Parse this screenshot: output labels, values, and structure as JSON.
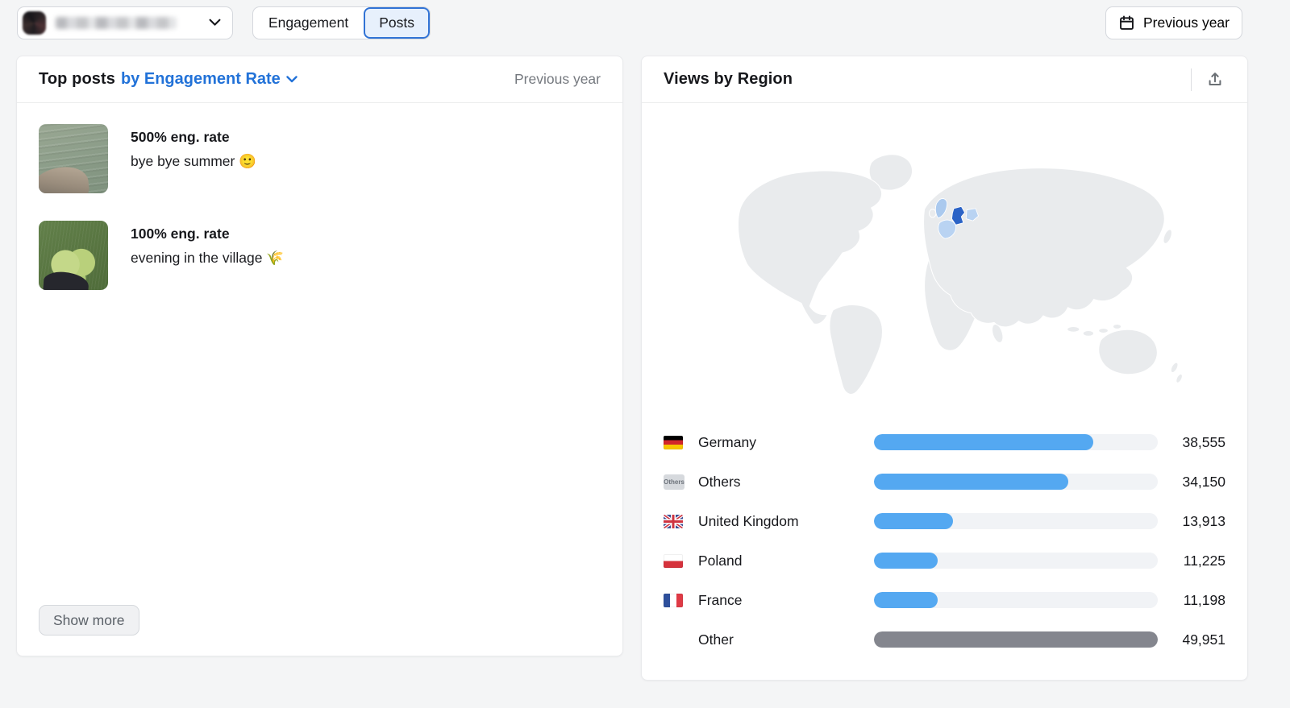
{
  "topbar": {
    "account_selector": {
      "name_redacted": true
    },
    "view_tabs": [
      {
        "label": "Engagement",
        "active": false
      },
      {
        "label": "Posts",
        "active": true
      }
    ],
    "period_button_label": "Previous year"
  },
  "top_posts_panel": {
    "title": "Top posts",
    "sort_selector_label": "by Engagement Rate",
    "period_label": "Previous year",
    "posts": [
      {
        "rate": "500% eng. rate",
        "caption": "bye bye summer 🙂"
      },
      {
        "rate": "100% eng. rate",
        "caption": "evening in the village 🌾"
      }
    ],
    "show_more_label": "Show more"
  },
  "views_panel": {
    "title": "Views by Region",
    "others_badge": "Others"
  },
  "chart_data": {
    "type": "bar",
    "orientation": "horizontal",
    "title": "Views by Region",
    "categories": [
      "Germany",
      "Others",
      "United Kingdom",
      "Poland",
      "France",
      "Other"
    ],
    "values": [
      38555,
      34150,
      13913,
      11225,
      11198,
      49951
    ],
    "value_labels": [
      "38,555",
      "34,150",
      "13,913",
      "11,225",
      "11,198",
      "49,951"
    ],
    "bar_colors": [
      "#54a8f1",
      "#54a8f1",
      "#54a8f1",
      "#54a8f1",
      "#54a8f1",
      "#84868e"
    ],
    "flags": [
      "de",
      "others",
      "gb",
      "pl",
      "fr",
      "none"
    ],
    "xlim": [
      0,
      49951
    ],
    "map_highlight": {
      "primary": "Germany",
      "secondary": [
        "United Kingdom",
        "Poland",
        "France"
      ]
    }
  },
  "colors": {
    "accent_blue": "#2272d8",
    "bar_blue": "#54a8f1",
    "bar_gray": "#84868e",
    "bar_track": "#f1f3f6",
    "map_land": "#e9ebed",
    "map_primary": "#2b63c6",
    "map_secondary": "#b9d3f2"
  }
}
